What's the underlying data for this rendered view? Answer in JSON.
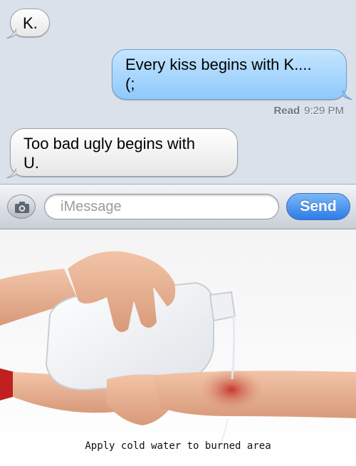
{
  "conversation": {
    "messages": [
      {
        "direction": "incoming",
        "lines": [
          "K."
        ]
      },
      {
        "direction": "outgoing",
        "lines": [
          "Every kiss begins with K....",
          "(;"
        ]
      },
      {
        "direction": "incoming",
        "lines": [
          "Too bad ugly begins with",
          "U."
        ]
      }
    ],
    "read_receipt": {
      "label": "Read",
      "time": "9:29 PM"
    }
  },
  "compose": {
    "placeholder": "iMessage",
    "send_label": "Send",
    "camera_icon": "camera-icon"
  },
  "meme_photo": {
    "caption": "Apply cold water to burned area"
  },
  "colors": {
    "messages_background": "#dbe1ea",
    "outgoing_bubble": "#8fc9fb",
    "incoming_bubble": "#ffffff",
    "send_button": "#2c7be6",
    "burn_red": "#c8352e"
  }
}
